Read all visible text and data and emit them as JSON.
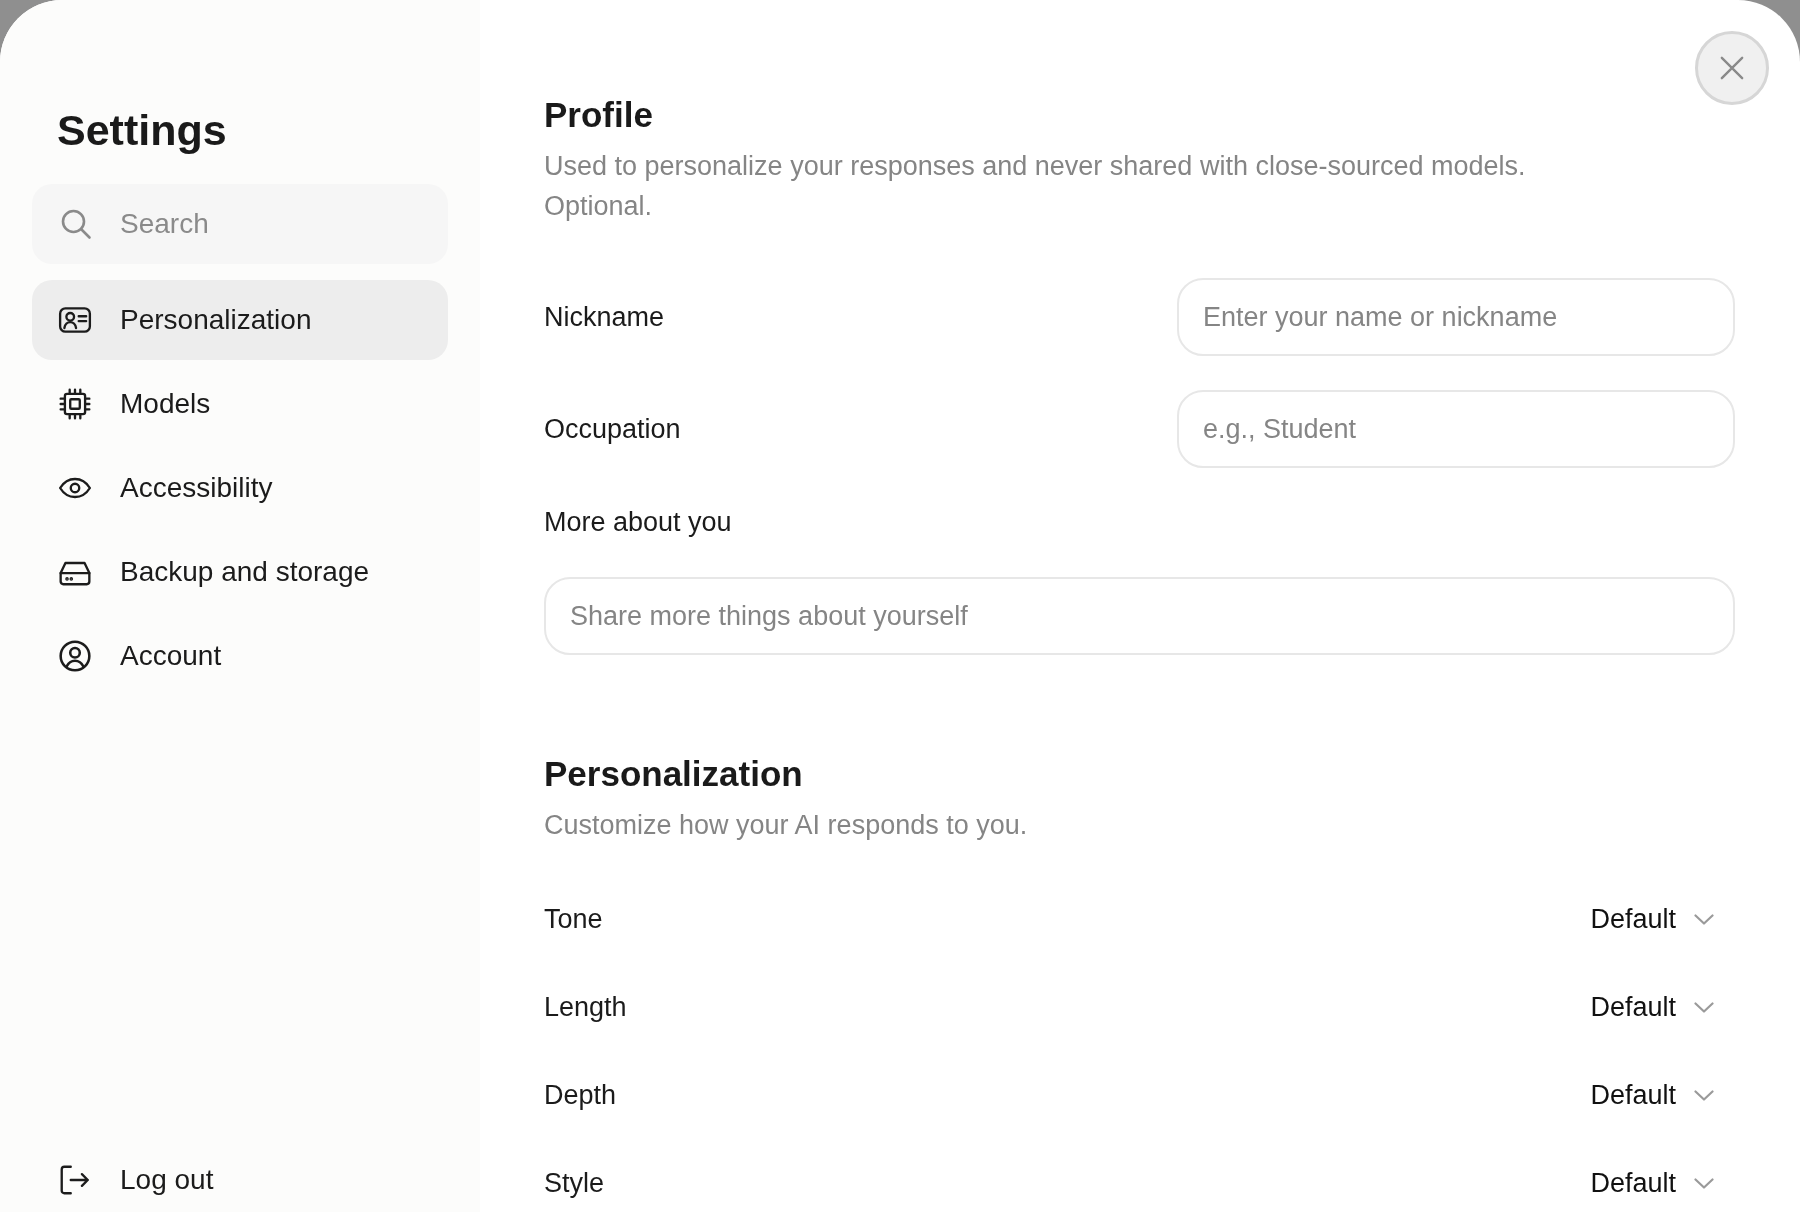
{
  "sidebar": {
    "title": "Settings",
    "search": {
      "placeholder": "Search"
    },
    "items": [
      {
        "label": "Personalization",
        "selected": true
      },
      {
        "label": "Models",
        "selected": false
      },
      {
        "label": "Accessibility",
        "selected": false
      },
      {
        "label": "Backup and storage",
        "selected": false
      },
      {
        "label": "Account",
        "selected": false
      }
    ],
    "footer_item": {
      "label": "Log out"
    }
  },
  "profile": {
    "title": "Profile",
    "description": "Used to personalize your responses and never shared with close-sourced models. Optional.",
    "fields": [
      {
        "kind": "inline",
        "label": "Nickname",
        "placeholder": "Enter your name or nickname"
      },
      {
        "kind": "inline",
        "label": "Occupation",
        "placeholder": "e.g., Student"
      },
      {
        "kind": "stacked",
        "label": "More about you",
        "placeholder": "Share more things about yourself"
      }
    ]
  },
  "personalization": {
    "title": "Personalization",
    "description": "Customize how your AI responds to you.",
    "options": [
      {
        "label": "Tone",
        "value": "Default"
      },
      {
        "label": "Length",
        "value": "Default"
      },
      {
        "label": "Depth",
        "value": "Default"
      },
      {
        "label": "Style",
        "value": "Default"
      }
    ]
  }
}
